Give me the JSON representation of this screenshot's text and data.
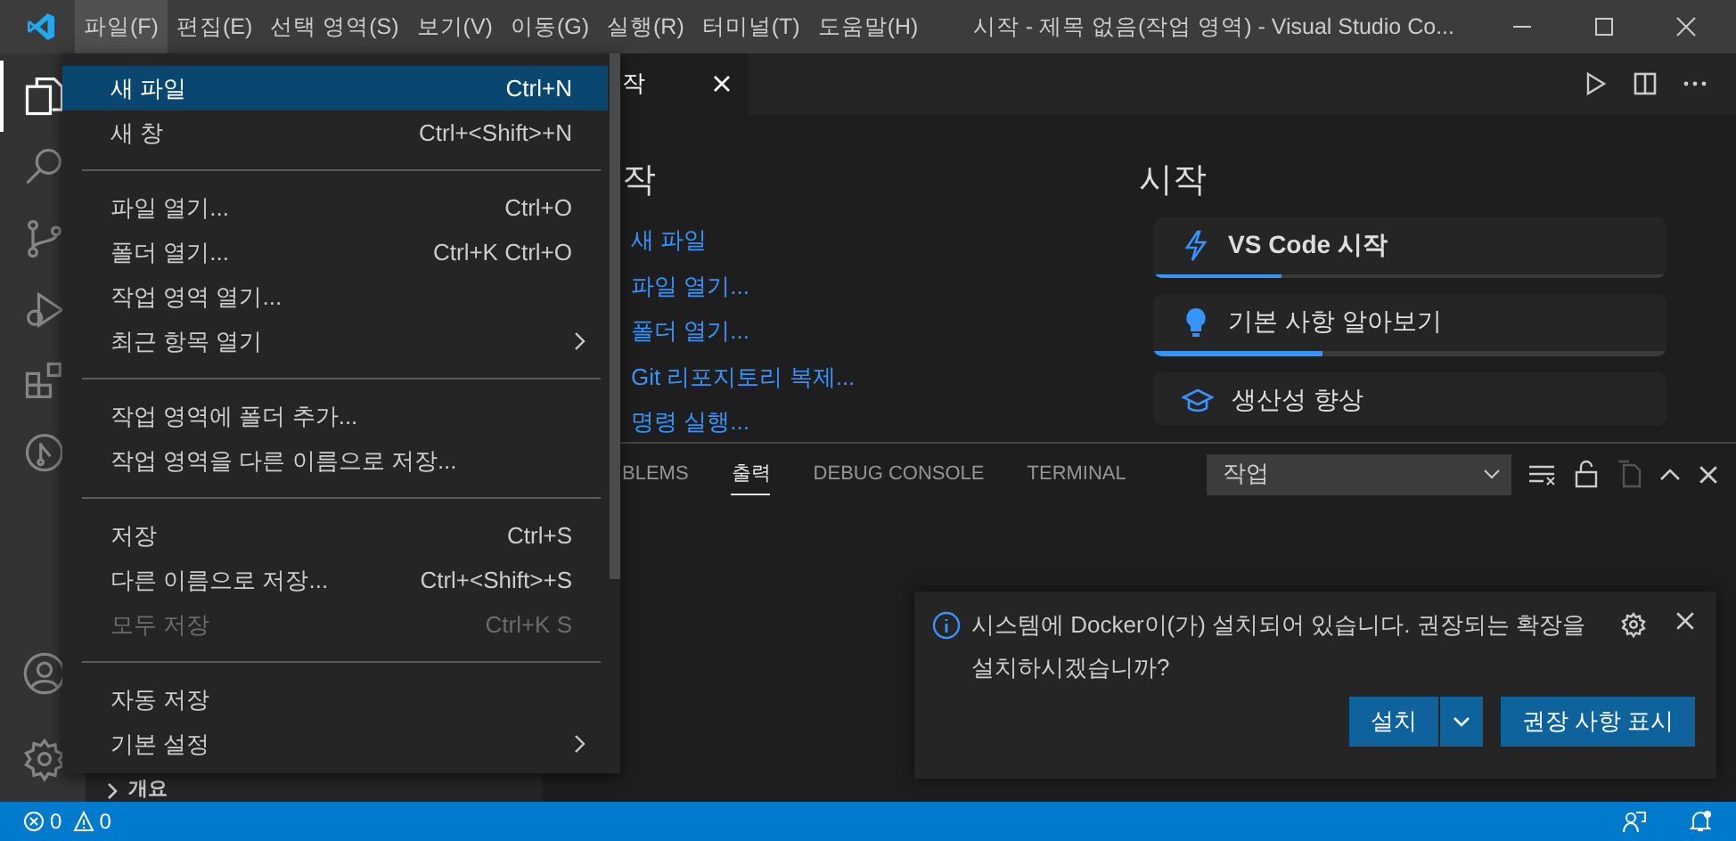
{
  "title_bar": {
    "title": "시작 - 제목 없음(작업 영역) - Visual Studio Co...",
    "menus": [
      {
        "label": "파일(F)",
        "selected": true
      },
      {
        "label": "편집(E)",
        "selected": false
      },
      {
        "label": "선택 영역(S)",
        "selected": false
      },
      {
        "label": "보기(V)",
        "selected": false
      },
      {
        "label": "이동(G)",
        "selected": false
      },
      {
        "label": "실행(R)",
        "selected": false
      },
      {
        "label": "터미널(T)",
        "selected": false
      },
      {
        "label": "도움말(H)",
        "selected": false
      }
    ]
  },
  "activity_bar": {
    "items": [
      {
        "selected": true
      },
      {
        "selected": false
      },
      {
        "selected": false
      },
      {
        "selected": false
      },
      {
        "selected": false
      },
      {
        "selected": false
      }
    ],
    "bottom": [
      {
        "selected": false
      },
      {
        "selected": false
      }
    ]
  },
  "sidebar": {
    "section": {
      "label": "개요",
      "expanded": false
    }
  },
  "editor": {
    "tabs": [
      {
        "label": "작",
        "selected": true
      }
    ],
    "welcome": {
      "left": {
        "heading": "작",
        "links": [
          "새 파일",
          "파일 열기...",
          "폴더 열기...",
          "Git 리포지토리 복제...",
          "명령 실행..."
        ]
      },
      "right": {
        "heading": "시작",
        "walkthroughs": [
          {
            "title": "VS Code 시작",
            "level": 0.25
          },
          {
            "title": "기본 사항 알아보기",
            "level": 0.33
          },
          {
            "title": "생산성 향상"
          }
        ]
      }
    }
  },
  "panel": {
    "tabs": [
      {
        "label": "BLEMS",
        "selected": false
      },
      {
        "label": "출력",
        "selected": true
      },
      {
        "label": "DEBUG CONSOLE",
        "selected": false
      },
      {
        "label": "TERMINAL",
        "selected": false
      }
    ],
    "output_select": "작업"
  },
  "notification": {
    "message": "시스템에 Docker이(가) 설치되어 있습니다. 권장되는 확장을 설치하시겠습니까?",
    "buttons": [
      {
        "label": "설치",
        "kind": "split"
      },
      {
        "label": "권장 사항 표시",
        "kind": "plain"
      }
    ]
  },
  "file_menu": {
    "items": [
      {
        "kind": "item",
        "label": "새 파일",
        "shortcut": "Ctrl+N",
        "selected": true,
        "disabled": false
      },
      {
        "kind": "item",
        "label": "새 창",
        "shortcut": "Ctrl+<Shift>+N",
        "selected": false,
        "disabled": false
      },
      {
        "kind": "separator"
      },
      {
        "kind": "item",
        "label": "파일 열기...",
        "shortcut": "Ctrl+O",
        "selected": false,
        "disabled": false
      },
      {
        "kind": "item",
        "label": "폴더 열기...",
        "shortcut": "Ctrl+K Ctrl+O",
        "selected": false,
        "disabled": false
      },
      {
        "kind": "item",
        "label": "작업 영역 열기...",
        "selected": false,
        "disabled": false
      },
      {
        "kind": "submenu",
        "label": "최근 항목 열기",
        "selected": false,
        "disabled": false
      },
      {
        "kind": "separator"
      },
      {
        "kind": "item",
        "label": "작업 영역에 폴더 추가...",
        "selected": false,
        "disabled": false
      },
      {
        "kind": "item",
        "label": "작업 영역을 다른 이름으로 저장...",
        "selected": false,
        "disabled": false
      },
      {
        "kind": "separator"
      },
      {
        "kind": "item",
        "label": "저장",
        "shortcut": "Ctrl+S",
        "selected": false,
        "disabled": false
      },
      {
        "kind": "item",
        "label": "다른 이름으로 저장...",
        "shortcut": "Ctrl+<Shift>+S",
        "selected": false,
        "disabled": false
      },
      {
        "kind": "item",
        "label": "모두 저장",
        "shortcut": "Ctrl+K S",
        "selected": false,
        "disabled": true
      },
      {
        "kind": "separator"
      },
      {
        "kind": "item",
        "label": "자동 저장",
        "selected": false,
        "disabled": false
      },
      {
        "kind": "submenu",
        "label": "기본 설정",
        "selected": false,
        "disabled": false
      }
    ]
  },
  "status_bar": {
    "errors": "0",
    "warnings": "0"
  }
}
